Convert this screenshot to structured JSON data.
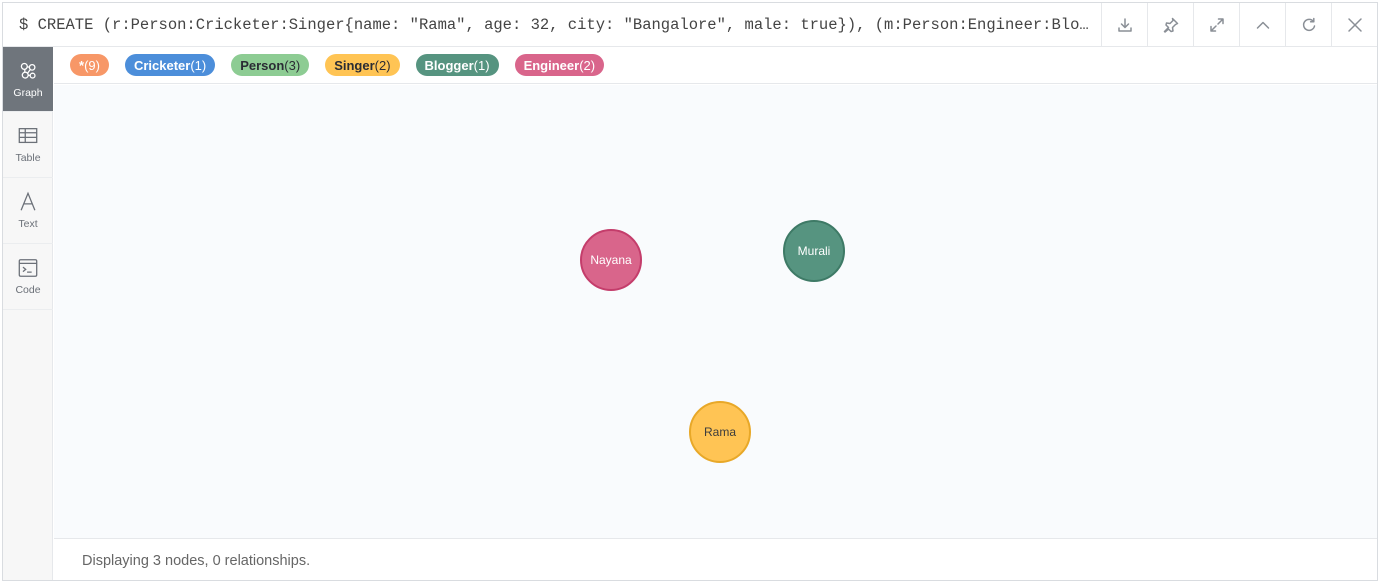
{
  "query": {
    "text": "$ CREATE (r:Person:Cricketer:Singer{name: \"Rama\", age: 32, city: \"Bangalore\", male: true}),  (m:Person:Engineer:Blogger{…"
  },
  "header_buttons": [
    {
      "icon": "download-icon"
    },
    {
      "icon": "pin-icon"
    },
    {
      "icon": "expand-icon"
    },
    {
      "icon": "collapse-up-icon"
    },
    {
      "icon": "rerun-icon"
    },
    {
      "icon": "close-icon"
    }
  ],
  "sidebar": {
    "items": [
      {
        "label": "Graph",
        "icon": "graph-icon",
        "active": true
      },
      {
        "label": "Table",
        "icon": "table-icon",
        "active": false
      },
      {
        "label": "Text",
        "icon": "text-icon",
        "active": false
      },
      {
        "label": "Code",
        "icon": "code-icon",
        "active": false
      }
    ]
  },
  "labels": [
    {
      "name": "*",
      "count": "(9)",
      "bg": "#f79767",
      "fg": "#ffffff"
    },
    {
      "name": "Cricketer",
      "count": "(1)",
      "bg": "#4c8eda",
      "fg": "#ffffff"
    },
    {
      "name": "Person",
      "count": "(3)",
      "bg": "#8dcc93",
      "fg": "#2a2c34"
    },
    {
      "name": "Singer",
      "count": "(2)",
      "bg": "#ffc454",
      "fg": "#2a2c34"
    },
    {
      "name": "Blogger",
      "count": "(1)",
      "bg": "#569480",
      "fg": "#ffffff"
    },
    {
      "name": "Engineer",
      "count": "(2)",
      "bg": "#d9658b",
      "fg": "#ffffff"
    }
  ],
  "nodes": [
    {
      "name": "Nayana",
      "fill": "#d9658b",
      "stroke": "#c43d6b",
      "fg": "#ffffff"
    },
    {
      "name": "Murali",
      "fill": "#569480",
      "stroke": "#3e7a66",
      "fg": "#ffffff"
    },
    {
      "name": "Rama",
      "fill": "#ffc454",
      "stroke": "#e8a828",
      "fg": "#3d3d3d"
    }
  ],
  "footer": {
    "status": "Displaying 3 nodes, 0 relationships."
  }
}
